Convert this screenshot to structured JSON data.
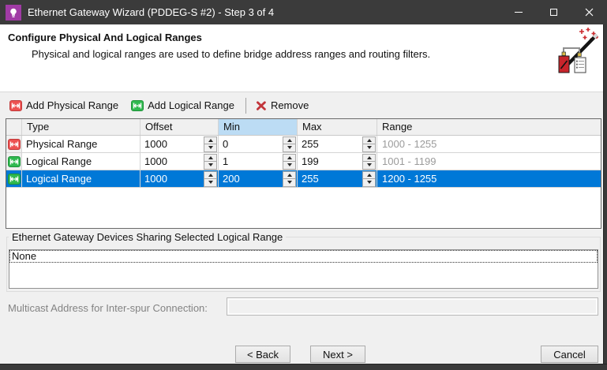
{
  "window": {
    "title": "Ethernet Gateway Wizard (PDDEG-S #2) - Step 3 of 4",
    "icons": {
      "app": "lightbulb-icon",
      "minimize": "minimize-icon",
      "maximize": "maximize-icon",
      "close": "close-icon"
    }
  },
  "header": {
    "title": "Configure Physical And Logical Ranges",
    "subtitle": "Physical and logical ranges are used to define bridge address ranges and routing filters.",
    "icon": "wizard-wand-icon"
  },
  "toolbar": {
    "add_physical_label": "Add Physical Range",
    "add_logical_label": "Add Logical Range",
    "remove_label": "Remove"
  },
  "table": {
    "columns": [
      "Type",
      "Offset",
      "Min",
      "Max",
      "Range"
    ],
    "highlighted_column": "Min",
    "rows": [
      {
        "icon": "physical-range-icon",
        "type": "Physical Range",
        "offset": "1000",
        "min": "0",
        "max": "255",
        "range": "1000 - 1255",
        "selected": false
      },
      {
        "icon": "logical-range-icon",
        "type": "Logical Range",
        "offset": "1000",
        "min": "1",
        "max": "199",
        "range": "1001 - 1199",
        "selected": false
      },
      {
        "icon": "logical-range-icon",
        "type": "Logical Range",
        "offset": "1000",
        "min": "200",
        "max": "255",
        "range": "1200 - 1255",
        "selected": true
      }
    ]
  },
  "group_box": {
    "title": "Ethernet Gateway Devices Sharing Selected Logical Range",
    "items": [
      "None"
    ]
  },
  "multicast": {
    "label": "Multicast Address for Inter-spur Connection:",
    "value": ""
  },
  "footer": {
    "back_label": "< Back",
    "next_label": "Next >",
    "cancel_label": "Cancel"
  },
  "colors": {
    "titlebar": "#3b3b3b",
    "frame": "#3a3a3a",
    "dialog-bg": "#f0f0f0",
    "app-icon": "#a03ba5",
    "selection": "#0078d7",
    "header-highlight": "#bcdcf4",
    "physical": "#ed5151",
    "physical-border": "#c03a3a",
    "logical": "#2fb94f",
    "logical-border": "#1f9239",
    "muted-text": "#9b9b9b",
    "disabled-text": "#838383",
    "remove-x": "#c2353b"
  }
}
